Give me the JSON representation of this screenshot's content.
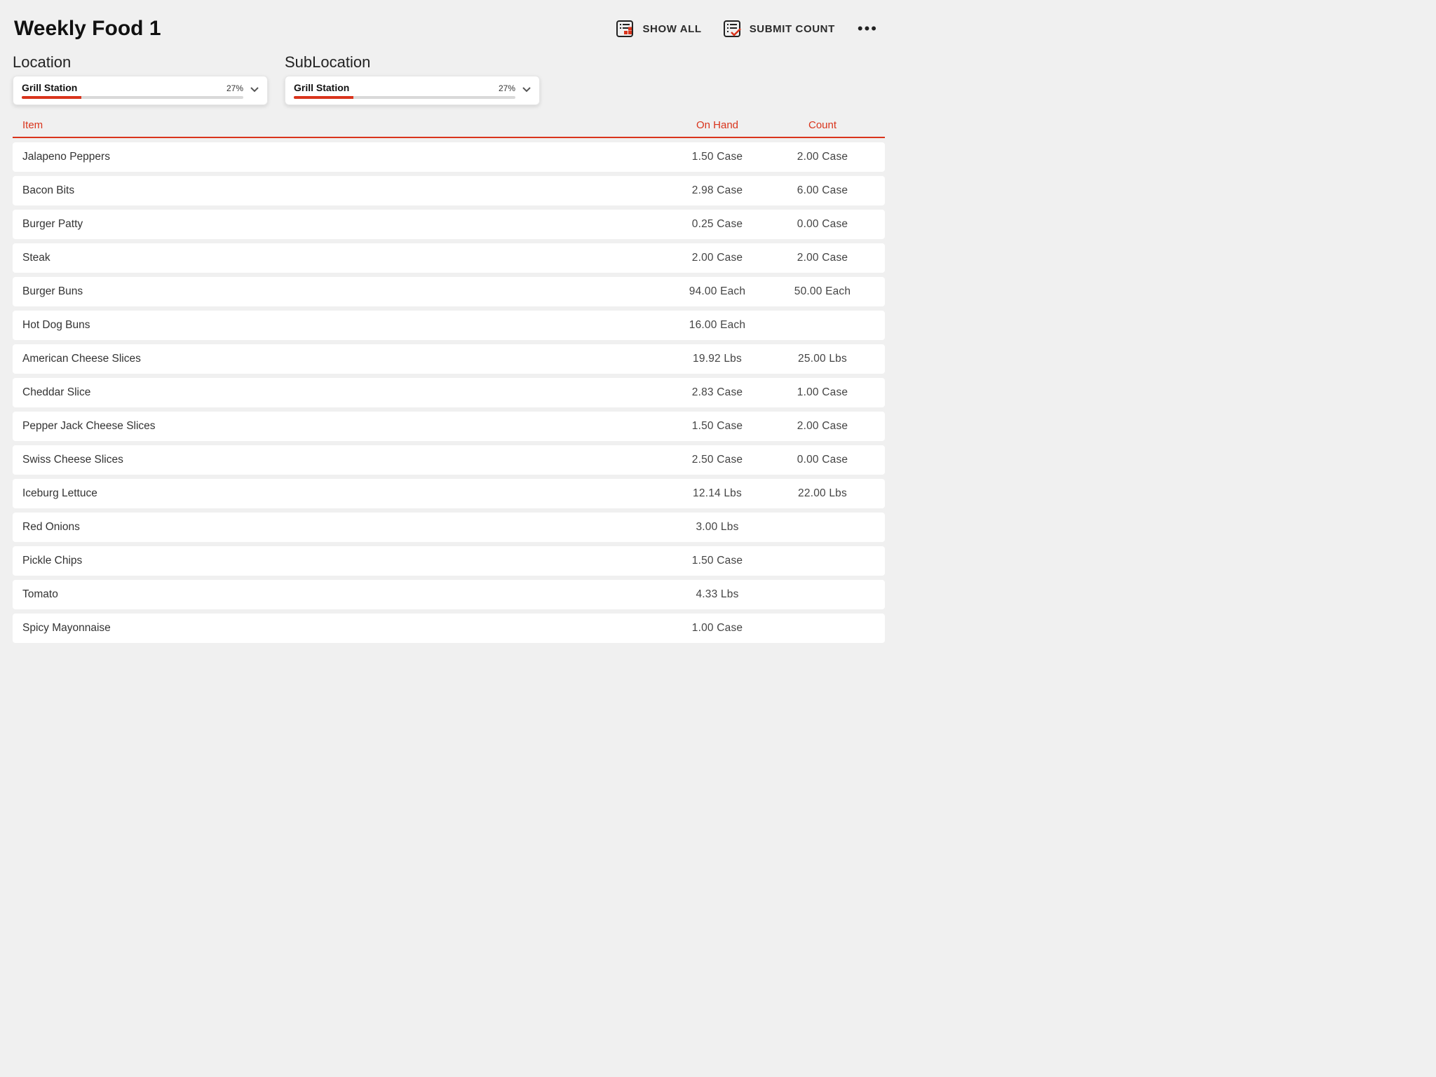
{
  "header": {
    "title": "Weekly Food 1",
    "show_all_label": "SHOW ALL",
    "submit_label": "SUBMIT COUNT"
  },
  "filters": {
    "location": {
      "label": "Location",
      "value": "Grill Station",
      "percent_label": "27%",
      "percent_value": 27
    },
    "sublocation": {
      "label": "SubLocation",
      "value": "Grill Station",
      "percent_label": "27%",
      "percent_value": 27
    }
  },
  "columns": {
    "item": "Item",
    "on_hand": "On Hand",
    "count": "Count"
  },
  "rows": [
    {
      "item": "Jalapeno Peppers",
      "on_hand": "1.50 Case",
      "count": "2.00 Case"
    },
    {
      "item": "Bacon Bits",
      "on_hand": "2.98 Case",
      "count": "6.00 Case"
    },
    {
      "item": "Burger Patty",
      "on_hand": "0.25 Case",
      "count": "0.00 Case"
    },
    {
      "item": "Steak",
      "on_hand": "2.00 Case",
      "count": "2.00 Case"
    },
    {
      "item": "Burger Buns",
      "on_hand": "94.00 Each",
      "count": "50.00 Each"
    },
    {
      "item": "Hot Dog Buns",
      "on_hand": "16.00 Each",
      "count": ""
    },
    {
      "item": "American Cheese Slices",
      "on_hand": "19.92 Lbs",
      "count": "25.00 Lbs"
    },
    {
      "item": "Cheddar Slice",
      "on_hand": "2.83 Case",
      "count": "1.00 Case"
    },
    {
      "item": "Pepper Jack Cheese Slices",
      "on_hand": "1.50 Case",
      "count": "2.00 Case"
    },
    {
      "item": "Swiss Cheese Slices",
      "on_hand": "2.50 Case",
      "count": "0.00 Case"
    },
    {
      "item": "Iceburg Lettuce",
      "on_hand": "12.14 Lbs",
      "count": "22.00 Lbs"
    },
    {
      "item": "Red Onions",
      "on_hand": "3.00 Lbs",
      "count": ""
    },
    {
      "item": "Pickle Chips",
      "on_hand": "1.50 Case",
      "count": ""
    },
    {
      "item": "Tomato",
      "on_hand": "4.33 Lbs",
      "count": ""
    },
    {
      "item": "Spicy Mayonnaise",
      "on_hand": "1.00 Case",
      "count": ""
    }
  ]
}
